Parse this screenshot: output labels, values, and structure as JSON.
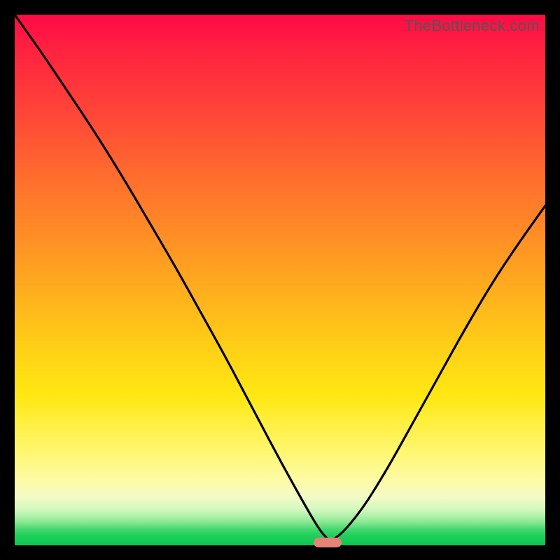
{
  "watermark": "TheBottleneck.com",
  "colors": {
    "background": "#000000",
    "curve_stroke": "#000000",
    "marker_fill": "#e88377",
    "watermark_text": "#555555"
  },
  "chart_data": {
    "type": "line",
    "title": "",
    "xlabel": "",
    "ylabel": "",
    "xlim": [
      0,
      100
    ],
    "ylim": [
      0,
      100
    ],
    "series": [
      {
        "name": "bottleneck-curve",
        "x": [
          0,
          5,
          10,
          15,
          20,
          25,
          30,
          35,
          40,
          45,
          50,
          55,
          58,
          60,
          65,
          70,
          75,
          80,
          85,
          90,
          95,
          100
        ],
        "values": [
          100,
          93,
          85.5,
          78,
          70,
          61.5,
          53,
          44,
          35,
          25.5,
          16,
          7,
          2,
          0.5,
          6,
          14,
          23,
          32,
          41,
          49.5,
          57,
          64
        ]
      }
    ],
    "minimum": {
      "x": 59,
      "y": 0
    },
    "gradient_key": [
      {
        "y": 100,
        "color": "#ff0a46"
      },
      {
        "y": 50,
        "color": "#ffb41c"
      },
      {
        "y": 20,
        "color": "#fff66d"
      },
      {
        "y": 5,
        "color": "#8fe994"
      },
      {
        "y": 0,
        "color": "#07c851"
      }
    ]
  }
}
